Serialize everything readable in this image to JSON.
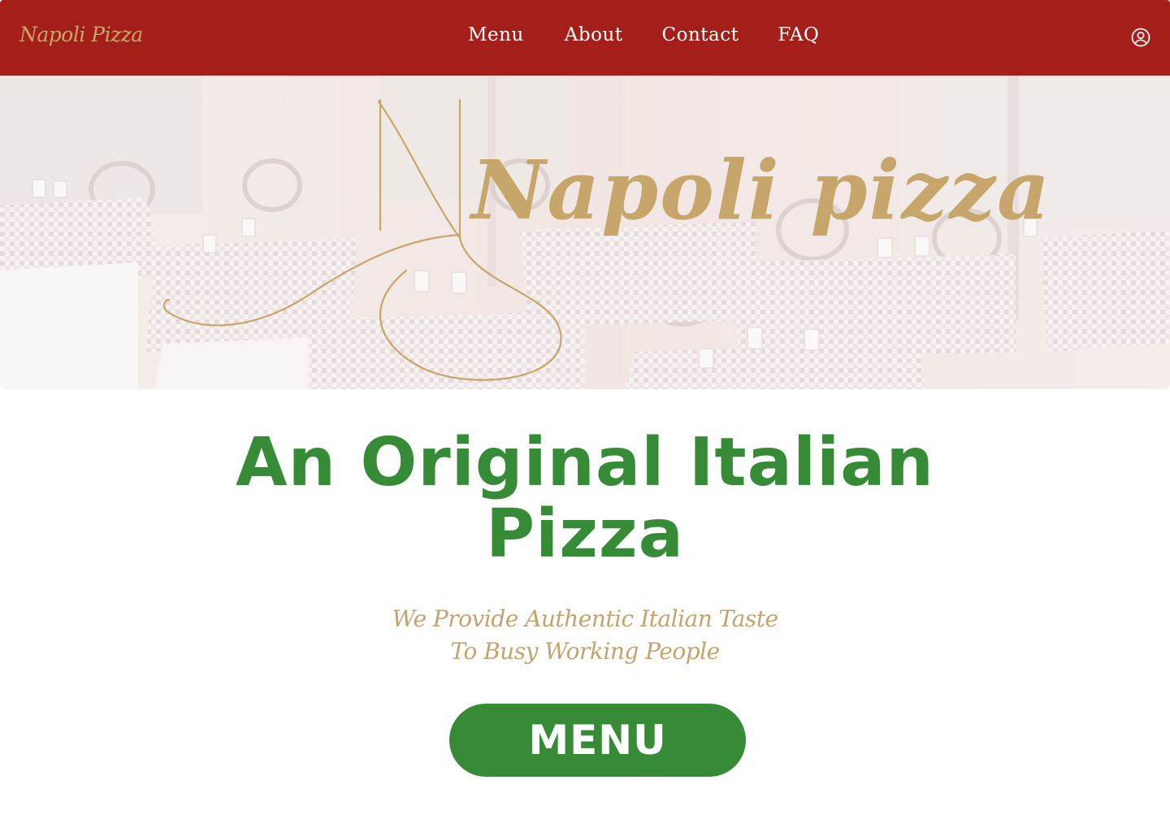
{
  "nav": {
    "brand": "Napoli Pizza",
    "links": [
      "Menu",
      "About",
      "Contact",
      "FAQ"
    ],
    "account_icon": "user-circle-icon"
  },
  "hero": {
    "image": "restaurant-interior-photo",
    "logo_text": "Napoli pizza"
  },
  "main": {
    "headline": [
      "An Original Italian",
      "Pizza"
    ],
    "tagline": [
      "We Provide Authentic Italian Taste",
      "To Busy Working People"
    ],
    "cta_label": "MENU"
  },
  "colors": {
    "nav_bg": "#a51f1a",
    "gold": "#c9a56a",
    "green": "#378b37",
    "white": "#ffffff"
  }
}
